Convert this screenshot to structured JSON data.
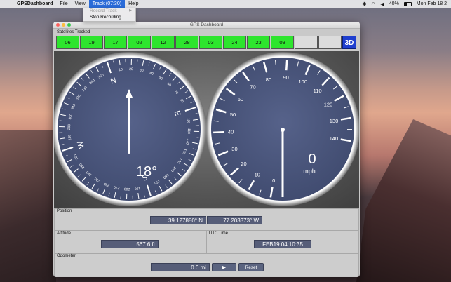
{
  "menubar": {
    "app_name": "GPSDashboard",
    "items": [
      "File",
      "View",
      "Track (07:30)",
      "Help"
    ],
    "status": {
      "battery": "40%",
      "clock": "Mon Feb 18 2"
    }
  },
  "track_menu": {
    "items": [
      {
        "label": "Record Track",
        "disabled": true,
        "has_submenu": true
      },
      {
        "label": "Stop Recording",
        "disabled": false,
        "has_submenu": false
      }
    ]
  },
  "window": {
    "title": "GPS Dashboard"
  },
  "satellites": {
    "label": "Satellites Tracked",
    "ids": [
      "06",
      "19",
      "17",
      "02",
      "12",
      "28",
      "03",
      "24",
      "23",
      "09",
      "",
      ""
    ],
    "fix": "3D",
    "colors": {
      "tracked": "#2ee52e",
      "empty": "#dcdcdc",
      "fix_bg": "#1f3fcf"
    }
  },
  "compass": {
    "heading_deg": 18,
    "heading_text": "18°",
    "cardinals": [
      "N",
      "E",
      "S",
      "W"
    ],
    "degree_labels": [
      "10",
      "20",
      "30",
      "40",
      "50",
      "60",
      "70",
      "80",
      "100",
      "110",
      "120",
      "130",
      "140",
      "150",
      "160",
      "170",
      "190",
      "200",
      "210",
      "220",
      "230",
      "240",
      "250",
      "260",
      "280",
      "290",
      "300",
      "310",
      "320",
      "330",
      "340",
      "350"
    ]
  },
  "speedometer": {
    "speed": 0,
    "speed_text": "0",
    "unit": "mph",
    "scale_labels": [
      "0",
      "10",
      "20",
      "30",
      "40",
      "50",
      "60",
      "70",
      "80",
      "90",
      "100",
      "110",
      "120",
      "130",
      "140"
    ],
    "max": 140
  },
  "position": {
    "label": "Position",
    "latitude": "39.127880° N",
    "longitude": "77.203373° W"
  },
  "altitude": {
    "label": "Altitude",
    "value": "567.6 ft"
  },
  "utc": {
    "label": "UTC Time",
    "value": "FEB19 04:10:35"
  },
  "odometer": {
    "label": "Odometer",
    "value": "0.0 mi",
    "play_label": "▶",
    "reset_label": "Reset"
  }
}
